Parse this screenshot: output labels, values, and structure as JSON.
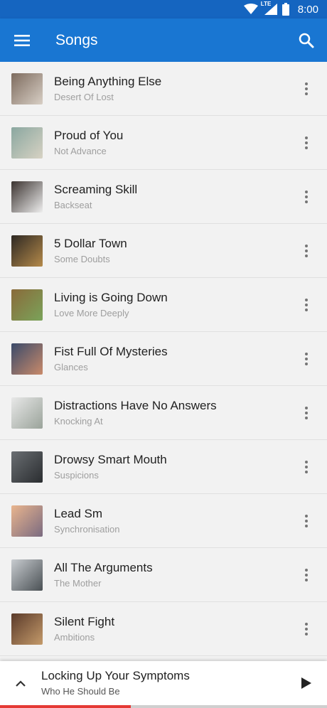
{
  "status_bar": {
    "time": "8:00",
    "network": "LTE",
    "color": "#1565c0"
  },
  "app_bar": {
    "title": "Songs",
    "menu_icon": "hamburger-menu-icon",
    "search_icon": "search-icon",
    "color": "#1976d2"
  },
  "songs": [
    {
      "title": "Being Anything Else",
      "artist": "Desert Of Lost",
      "thumb": [
        "#7d6b5e",
        "#d8cfc5"
      ]
    },
    {
      "title": "Proud of You",
      "artist": "Not Advance",
      "thumb": [
        "#8aa7a0",
        "#d7d2c3"
      ]
    },
    {
      "title": "Screaming Skill",
      "artist": "Backseat",
      "thumb": [
        "#3b3330",
        "#eeeeee"
      ]
    },
    {
      "title": "5 Dollar Town",
      "artist": "Some Doubts",
      "thumb": [
        "#2d2823",
        "#b58a4a"
      ]
    },
    {
      "title": "Living is Going Down",
      "artist": "Love More Deeply",
      "thumb": [
        "#8a6a3a",
        "#7aa35a"
      ]
    },
    {
      "title": "Fist Full Of Mysteries",
      "artist": "Glances",
      "thumb": [
        "#3a4a6a",
        "#c98a6a"
      ]
    },
    {
      "title": "Distractions Have No Answers",
      "artist": "Knocking At",
      "thumb": [
        "#e8e8e8",
        "#9aa39a"
      ]
    },
    {
      "title": "Drowsy Smart Mouth",
      "artist": "Suspicions",
      "thumb": [
        "#6a6e72",
        "#2a2d30"
      ]
    },
    {
      "title": "Lead Sm",
      "artist": "Synchronisation",
      "thumb": [
        "#e9b58e",
        "#7a6a80"
      ]
    },
    {
      "title": "All The Arguments",
      "artist": "The Mother",
      "thumb": [
        "#c8ccd0",
        "#4a5054"
      ]
    },
    {
      "title": "Silent Fight",
      "artist": "Ambitions",
      "thumb": [
        "#5a3a2a",
        "#c49a6a"
      ]
    }
  ],
  "now_playing": {
    "title": "Locking Up Your Symptoms",
    "artist": "Who He Should Be",
    "expand_icon": "chevron-up-icon",
    "play_icon": "play-icon",
    "progress": 0.4,
    "progress_color": "#e53935"
  }
}
